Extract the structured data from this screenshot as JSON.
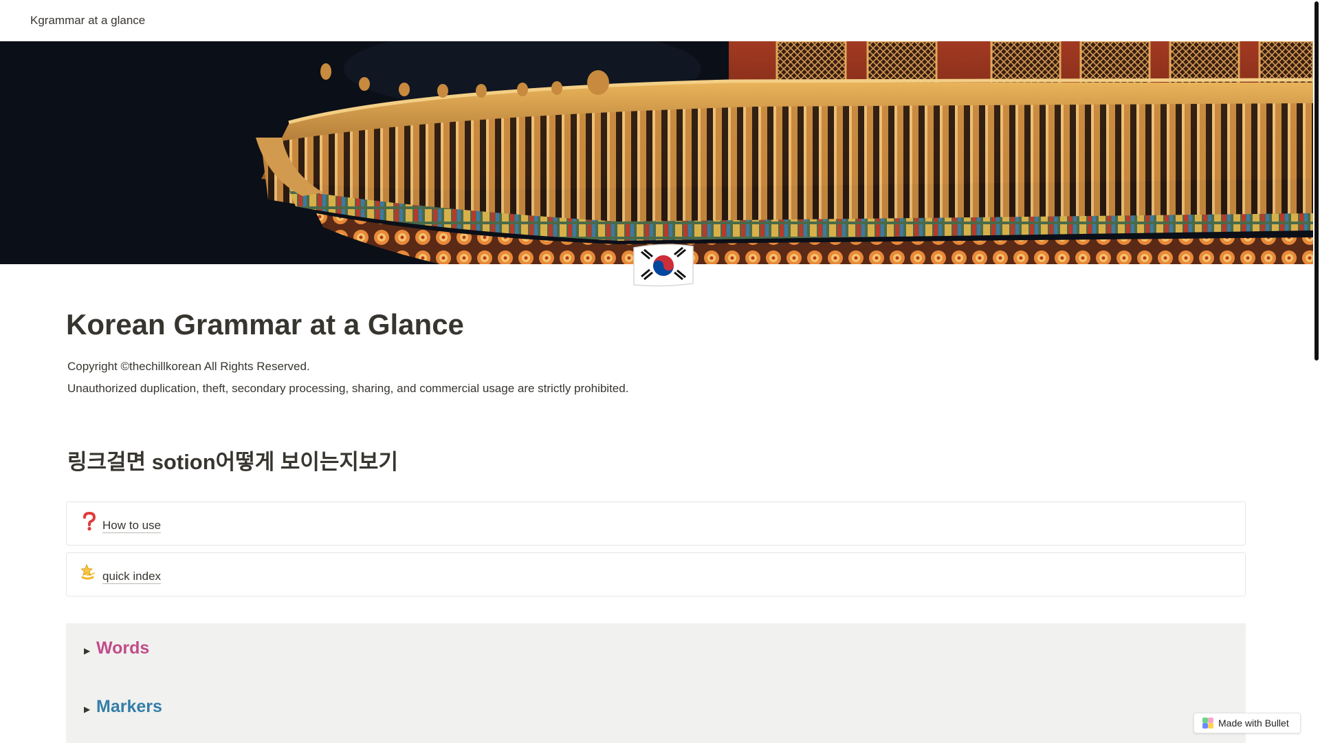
{
  "topbar": {
    "site_title": "Kgrammar at a glance"
  },
  "page": {
    "title": "Korean Grammar at a Glance",
    "copyright": "Copyright ©thechillkorean All Rights Reserved.",
    "notice": "Unauthorized duplication, theft, secondary processing, sharing, and commercial usage are strictly prohibited.",
    "heading": "링크걸면 sotion어떻게 보이는지보기"
  },
  "links": [
    {
      "label": "How to use",
      "icon": "question-mark-icon"
    },
    {
      "label": "quick index",
      "icon": "dizzy-star-icon"
    }
  ],
  "toggles": [
    {
      "label": "Words",
      "color": "#c14c8a"
    },
    {
      "label": "Markers",
      "color": "#337ea9"
    }
  ],
  "badge": {
    "text": "Made with Bullet"
  },
  "colors": {
    "text": "#37352f",
    "toggle_bg": "#f1f1ef",
    "card_border": "#e6e6e4"
  }
}
